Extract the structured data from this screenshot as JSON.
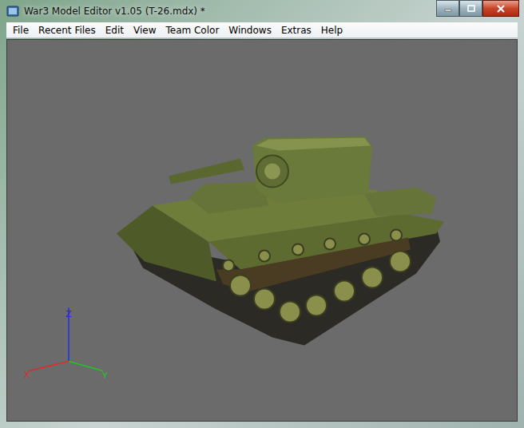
{
  "window": {
    "title": "War3 Model Editor v1.05 (T-26.mdx) *"
  },
  "menu": [
    "File",
    "Recent Files",
    "Edit",
    "View",
    "Team Color",
    "Windows",
    "Extras",
    "Help"
  ],
  "viewport": {
    "axes": [
      {
        "label": "Z",
        "color": "#2a2ae8"
      },
      {
        "label": "X",
        "color": "#e02a2a"
      },
      {
        "label": "Y",
        "color": "#22c422"
      }
    ]
  }
}
